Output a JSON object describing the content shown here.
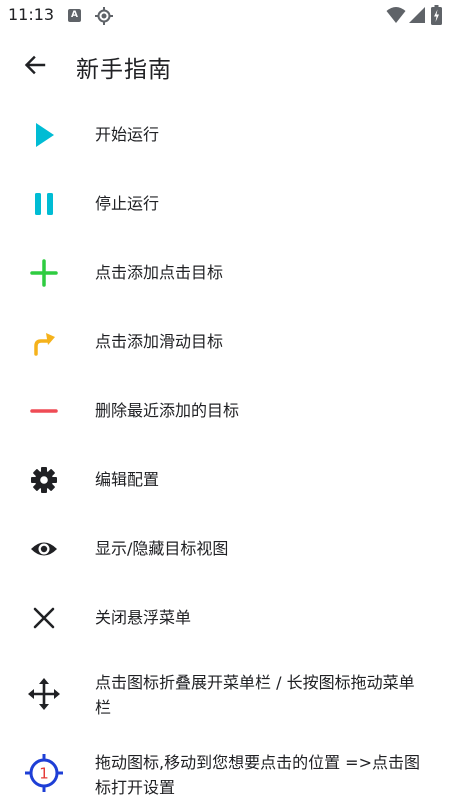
{
  "status_bar": {
    "time": "11:13",
    "icons": [
      "a-notification-icon",
      "gps-icon",
      "wifi-icon",
      "cellular-icon",
      "battery-charging-icon"
    ]
  },
  "app_bar": {
    "back_icon": "arrow-back-icon",
    "title": "新手指南"
  },
  "colors": {
    "play": "#00bcd4",
    "pause": "#00bcd4",
    "add": "#2ecc40",
    "swipe": "#f5b21b",
    "remove": "#ef4b55",
    "dark": "#202124",
    "target_blue": "#1e3fd6",
    "target_red": "#e53935"
  },
  "items": [
    {
      "icon": "play-icon",
      "label": "开始运行"
    },
    {
      "icon": "pause-icon",
      "label": "停止运行"
    },
    {
      "icon": "plus-icon",
      "label": "点击添加点击目标"
    },
    {
      "icon": "swipe-arrow-icon",
      "label": "点击添加滑动目标"
    },
    {
      "icon": "minus-icon",
      "label": "删除最近添加的目标"
    },
    {
      "icon": "gear-icon",
      "label": "编辑配置"
    },
    {
      "icon": "eye-icon",
      "label": "显示/隐藏目标视图"
    },
    {
      "icon": "close-icon",
      "label": "关闭悬浮菜单"
    },
    {
      "icon": "move-icon",
      "label": "点击图标折叠展开菜单栏 / 长按图标拖动菜单栏"
    },
    {
      "icon": "target-icon",
      "label": "拖动图标,移动到您想要点击的位置 =>点击图标打开设置",
      "icon_text": "1"
    }
  ]
}
